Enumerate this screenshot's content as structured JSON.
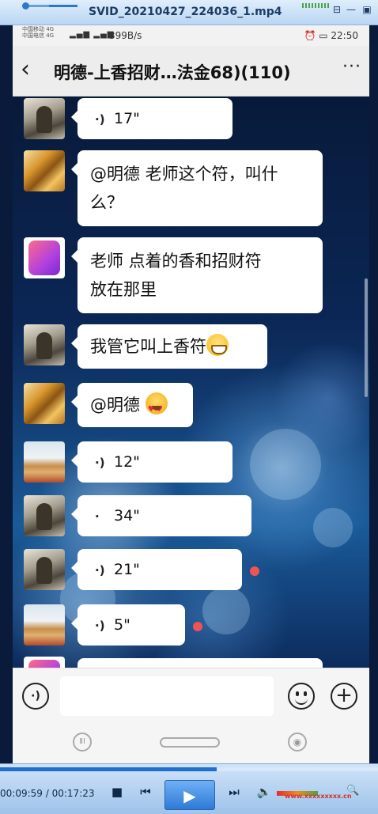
{
  "player": {
    "file_title": "SVID_20210427_224036_1.mp4",
    "current_time": "00:09:59",
    "total_time": "00:17:23",
    "time_separator": "/",
    "progress_fraction": 0.574,
    "watermark": "www.xxxxxxxxx.cn"
  },
  "status_bar": {
    "carrier_line1": "中国移动 4G",
    "carrier_line2": "中国电信 4G",
    "net_speed": "399B/s",
    "time": "22:50"
  },
  "chat_header": {
    "back_icon": "back-chevron-icon",
    "title": "明德-上香招财…法金68)(110)",
    "more_label": "···"
  },
  "messages": [
    {
      "sender_avatar": "sage-painting",
      "type": "voice",
      "duration": "17\"",
      "voice_icon": "voice-wave-icon"
    },
    {
      "sender_avatar": "golden-landscape",
      "type": "text",
      "lines": [
        "@明德  老师这个符，叫什",
        "么？"
      ]
    },
    {
      "sender_avatar": "pink-logo",
      "type": "text",
      "lines": [
        "老师  点着的香和招财符",
        "放在那里"
      ]
    },
    {
      "sender_avatar": "sage-painting",
      "type": "text",
      "text": "我管它叫上香符",
      "emoji": "grinning-face"
    },
    {
      "sender_avatar": "golden-landscape",
      "type": "text",
      "text": "@明德 ",
      "emoji": "heart-eyes-face"
    },
    {
      "sender_avatar": "tower-photo",
      "type": "voice",
      "duration": "12\"",
      "voice_icon": "voice-wave-icon"
    },
    {
      "sender_avatar": "sage-painting",
      "type": "voice",
      "duration": "34\"",
      "voice_icon": "voice-wave-icon"
    },
    {
      "sender_avatar": "sage-painting",
      "type": "voice",
      "duration": "21\"",
      "voice_icon": "voice-wave-icon",
      "unread": true
    },
    {
      "sender_avatar": "tower-photo",
      "type": "voice",
      "duration": "5\"",
      "voice_icon": "voice-wave-icon",
      "unread": true
    }
  ],
  "input_bar": {
    "voice_button_glyph": "◉",
    "plus_glyph": "+",
    "message_field_value": ""
  },
  "colors": {
    "bubble": "#ffffff",
    "unread_dot": "#f05353",
    "header_bg": "#ededed",
    "player_accent": "#1f6fd0"
  }
}
